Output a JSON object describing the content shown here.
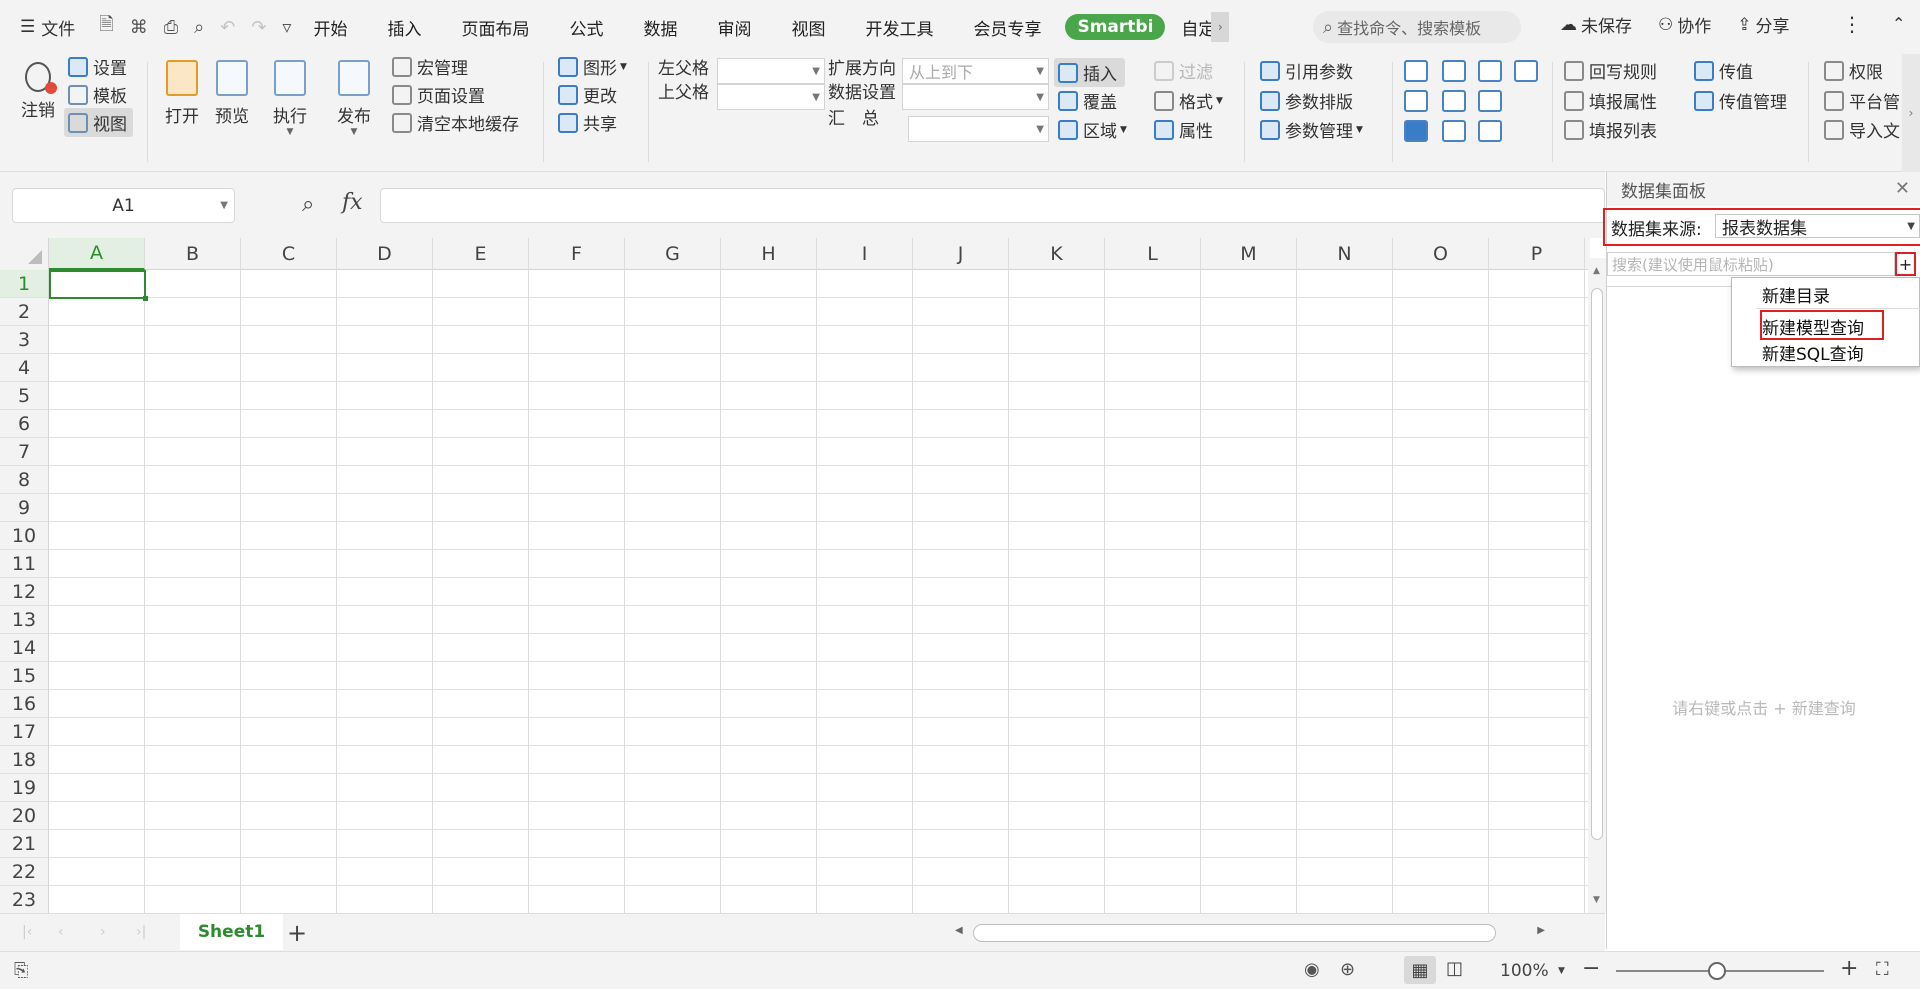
{
  "menubar": {
    "file_label": "文件",
    "tabs": [
      "开始",
      "插入",
      "页面布局",
      "公式",
      "数据",
      "审阅",
      "视图",
      "开发工具",
      "会员专享"
    ],
    "smartbi_label": "Smartbi",
    "custom_tab_label": "自定",
    "search_placeholder": "查找命令、搜索模板",
    "unsaved_label": "未保存",
    "collab_label": "协作",
    "share_label": "分享"
  },
  "ribbon": {
    "cancel_label": "注销",
    "settings_label": "设置",
    "template_label": "模板",
    "view_label": "视图",
    "open_label": "打开",
    "preview_label": "预览",
    "execute_label": "执行",
    "publish_label": "发布",
    "macro_label": "宏管理",
    "page_setup_label": "页面设置",
    "clear_cache_label": "清空本地缓存",
    "chart_label": "图形",
    "change_label": "更改",
    "share_label": "共享",
    "left_parent_label": "左父格",
    "top_parent_label": "上父格",
    "expand_dir_label": "扩展方向",
    "expand_dir_value": "从上到下",
    "data_setting_label": "数据设置",
    "summary_label": "汇　总",
    "insert_label": "插入",
    "cover_label": "覆盖",
    "area_label": "区域",
    "filter_label": "过滤",
    "format_label": "格式",
    "property_label": "属性",
    "ref_param_label": "引用参数",
    "param_layout_label": "参数排版",
    "param_manage_label": "参数管理",
    "writeback_rule_label": "回写规则",
    "fill_attr_label": "填报属性",
    "fill_list_label": "填报列表",
    "pass_value_label": "传值",
    "pass_manage_label": "传值管理",
    "permission_label": "权限",
    "platform_label": "平台管",
    "import_label": "导入文"
  },
  "formula": {
    "cell_ref": "A1",
    "fx_label": "fx",
    "value": ""
  },
  "grid": {
    "columns": [
      "A",
      "B",
      "C",
      "D",
      "E",
      "F",
      "G",
      "H",
      "I",
      "J",
      "K",
      "L",
      "M",
      "N",
      "O",
      "P"
    ],
    "rows": [
      "1",
      "2",
      "3",
      "4",
      "5",
      "6",
      "7",
      "8",
      "9",
      "10",
      "11",
      "12",
      "13",
      "14",
      "15",
      "16",
      "17",
      "18",
      "19",
      "20",
      "21",
      "22",
      "23"
    ],
    "selected_cell": "A1"
  },
  "sheets": {
    "tabs": [
      "Sheet1"
    ],
    "add_label": "+"
  },
  "status": {
    "zoom": "100%"
  },
  "panel": {
    "title": "数据集面板",
    "source_label": "数据集来源:",
    "source_value": "报表数据集",
    "search_placeholder": "搜索(建议使用鼠标粘贴)",
    "add_label": "+",
    "empty_hint": "请右键或点击 + 新建查询"
  },
  "context_menu": {
    "items": [
      "新建目录",
      "新建模型查询",
      "新建SQL查询"
    ],
    "highlighted": "新建模型查询"
  },
  "colors": {
    "accent_green": "#2e8a2e",
    "smartbi_green": "#4aa64a",
    "highlight_red": "#e02020"
  }
}
